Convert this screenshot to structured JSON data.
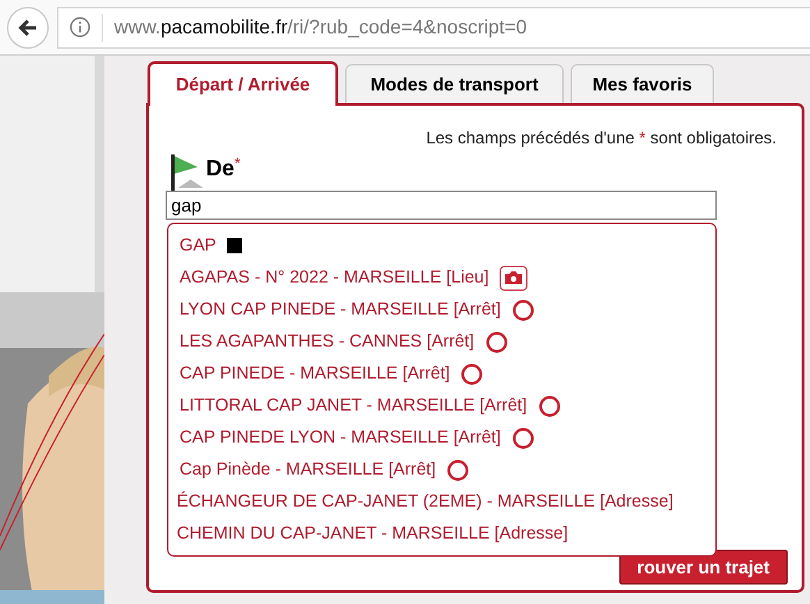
{
  "browser": {
    "url_host_prefix": "www.",
    "url_host": "pacamobilite.fr",
    "url_path": "/ri/?rub_code=4&noscript=0"
  },
  "tabs": [
    {
      "label": "Départ / Arrivée",
      "selected": true
    },
    {
      "label": "Modes de transport",
      "selected": false
    },
    {
      "label": "Mes favoris",
      "selected": false
    }
  ],
  "required_note": "Les champs précédés d'une * sont obligatoires.",
  "from_field": {
    "label": "De",
    "required_mark": "*",
    "value": "gap"
  },
  "suggestions": [
    {
      "text": "GAP",
      "kind": "square"
    },
    {
      "text": "AGAPAS - N° 2022 - MARSEILLE [Lieu]",
      "kind": "camera"
    },
    {
      "text": "LYON CAP PINEDE - MARSEILLE [Arrêt]",
      "kind": "stop"
    },
    {
      "text": "LES AGAPANTHES - CANNES [Arrêt]",
      "kind": "stop"
    },
    {
      "text": "CAP PINEDE - MARSEILLE [Arrêt]",
      "kind": "stop"
    },
    {
      "text": "LITTORAL CAP JANET - MARSEILLE [Arrêt]",
      "kind": "stop"
    },
    {
      "text": "CAP PINEDE LYON - MARSEILLE [Arrêt]",
      "kind": "stop"
    },
    {
      "text": "Cap Pinède - MARSEILLE [Arrêt]",
      "kind": "stop"
    },
    {
      "text": "ÉCHANGEUR DE CAP-JANET (2EME) - MARSEILLE [Adresse]",
      "kind": "address"
    },
    {
      "text": "CHEMIN DU CAP-JANET - MARSEILLE [Adresse]",
      "kind": "address"
    }
  ],
  "search_button": {
    "label": "rouver un trajet"
  }
}
